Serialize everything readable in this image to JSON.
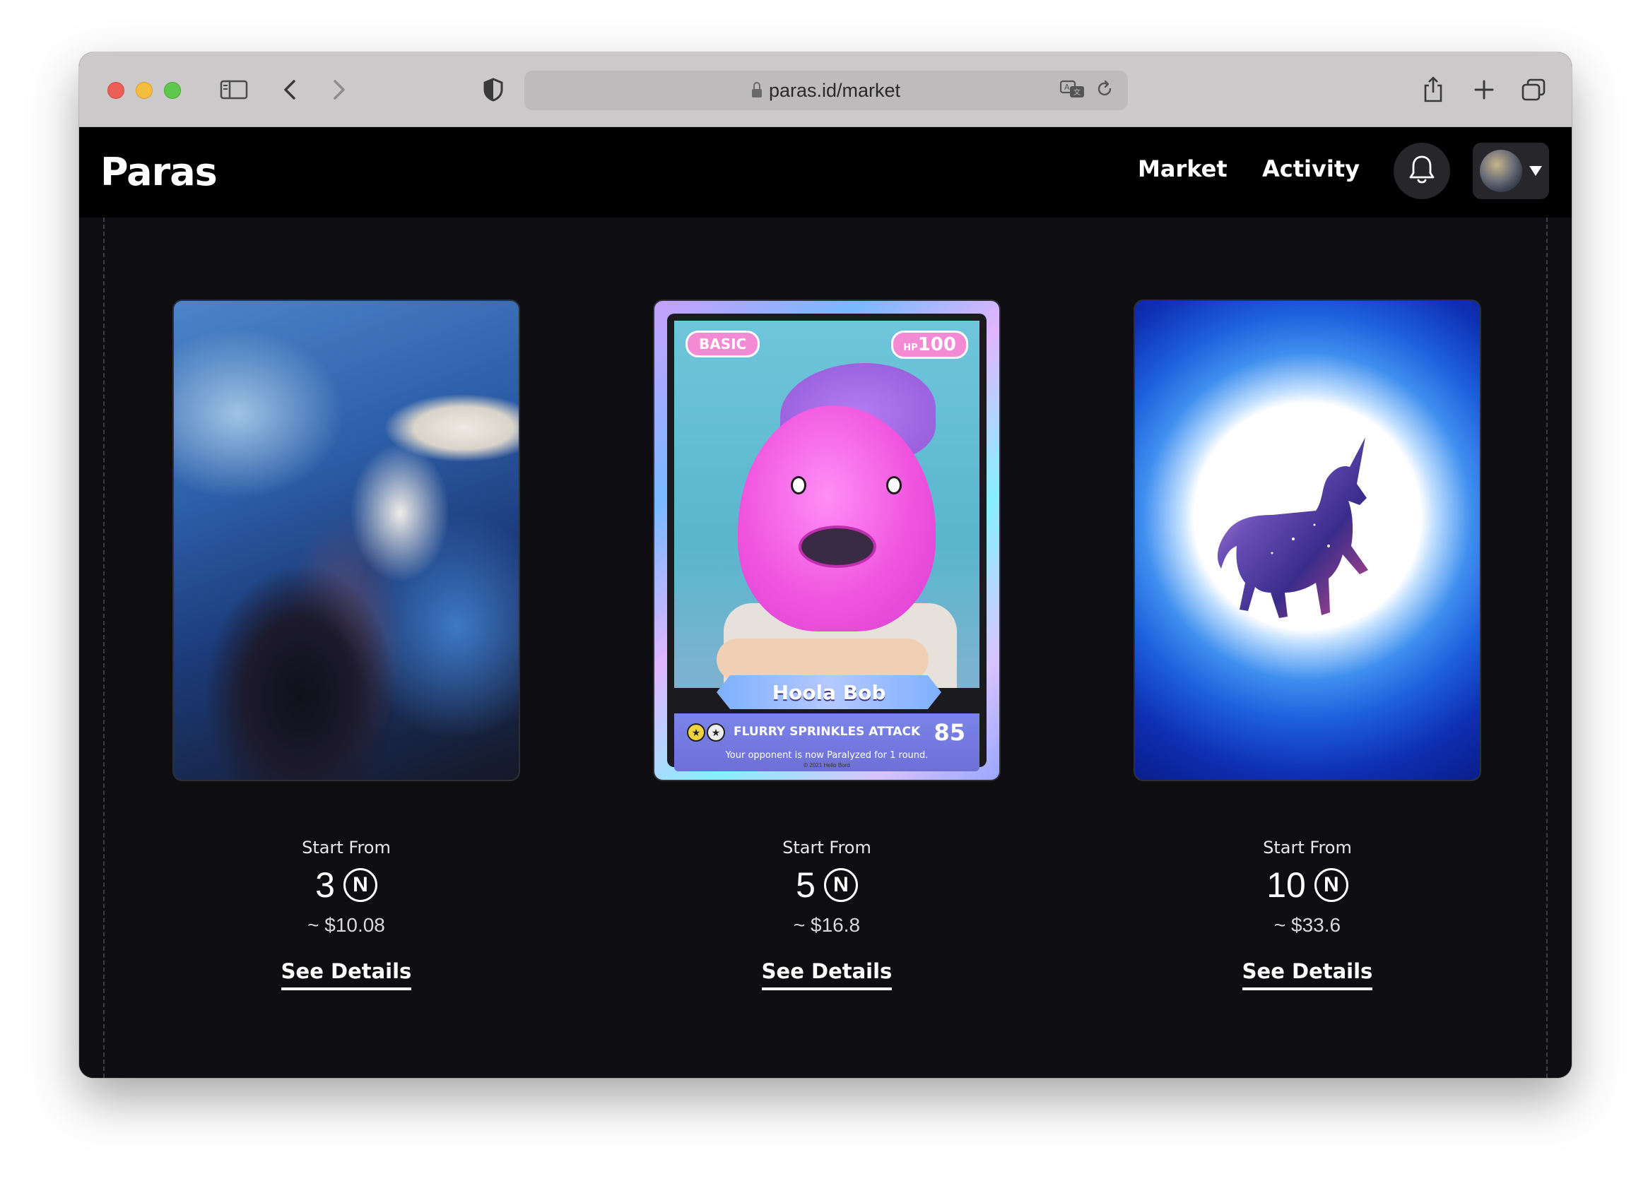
{
  "browser": {
    "url": "paras.id/market",
    "controls": {
      "sidebar_icon": "sidebar-icon",
      "back_icon": "chevron-left-icon",
      "forward_icon": "chevron-right-icon",
      "privacy_icon": "shield-icon",
      "translate_icon": "translate-icon",
      "reload_icon": "reload-icon",
      "share_icon": "share-icon",
      "new_tab_icon": "plus-icon",
      "tabs_icon": "tabs-overview-icon"
    }
  },
  "navbar": {
    "logo": "Paras",
    "links": [
      "Market",
      "Activity"
    ],
    "bell_icon": "bell-icon",
    "profile_caret": "caret-down-icon"
  },
  "cards": [
    {
      "art": "abstract-painting",
      "start_label": "Start From",
      "price": "3",
      "currency_symbol": "N",
      "usd": "~ $10.08",
      "details_label": "See Details"
    },
    {
      "art": "hoola-bob-trading-card",
      "card_text": {
        "stage": "BASIC",
        "hp_prefix": "HP",
        "hp": "100",
        "name": "Hoola Bob",
        "attack": "FLURRY SPRINKLES ATTACK",
        "damage": "85",
        "description": "Your opponent is now Paralyzed for 1 round.",
        "copyright": "© 2021 Hello Bord"
      },
      "start_label": "Start From",
      "price": "5",
      "currency_symbol": "N",
      "usd": "~ $16.8",
      "details_label": "See Details"
    },
    {
      "art": "cosmic-unicorn",
      "start_label": "Start From",
      "price": "10",
      "currency_symbol": "N",
      "usd": "~ $33.6",
      "details_label": "See Details"
    }
  ],
  "colors": {
    "navbar_bg": "#000000",
    "content_bg": "#0e0e12",
    "text": "#ffffff"
  }
}
